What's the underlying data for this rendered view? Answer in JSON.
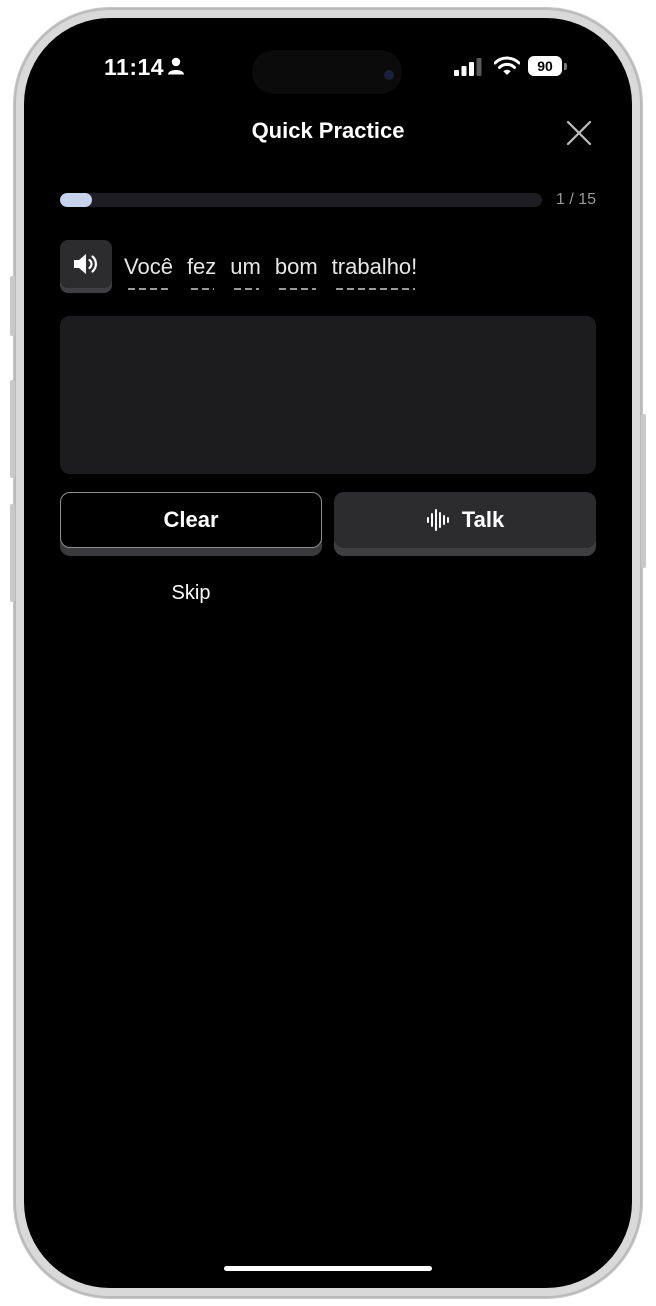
{
  "status_bar": {
    "time": "11:14",
    "battery": "90"
  },
  "header": {
    "title": "Quick Practice"
  },
  "progress": {
    "label": "1 / 15",
    "fraction": 0.0667
  },
  "sentence": {
    "words": [
      "Você",
      "fez",
      "um",
      "bom",
      "trabalho!"
    ]
  },
  "actions": {
    "clear_label": "Clear",
    "talk_label": "Talk",
    "skip_label": "Skip"
  },
  "icons": {
    "person": "person-icon",
    "signal": "cellular-signal-icon",
    "wifi": "wifi-icon",
    "close": "close-icon",
    "speaker": "speaker-icon",
    "waveform": "waveform-icon"
  },
  "colors": {
    "background": "#000000",
    "progress_fill": "#c6d3ec",
    "panel": "#1c1c1e",
    "button": "#2c2c2f"
  }
}
